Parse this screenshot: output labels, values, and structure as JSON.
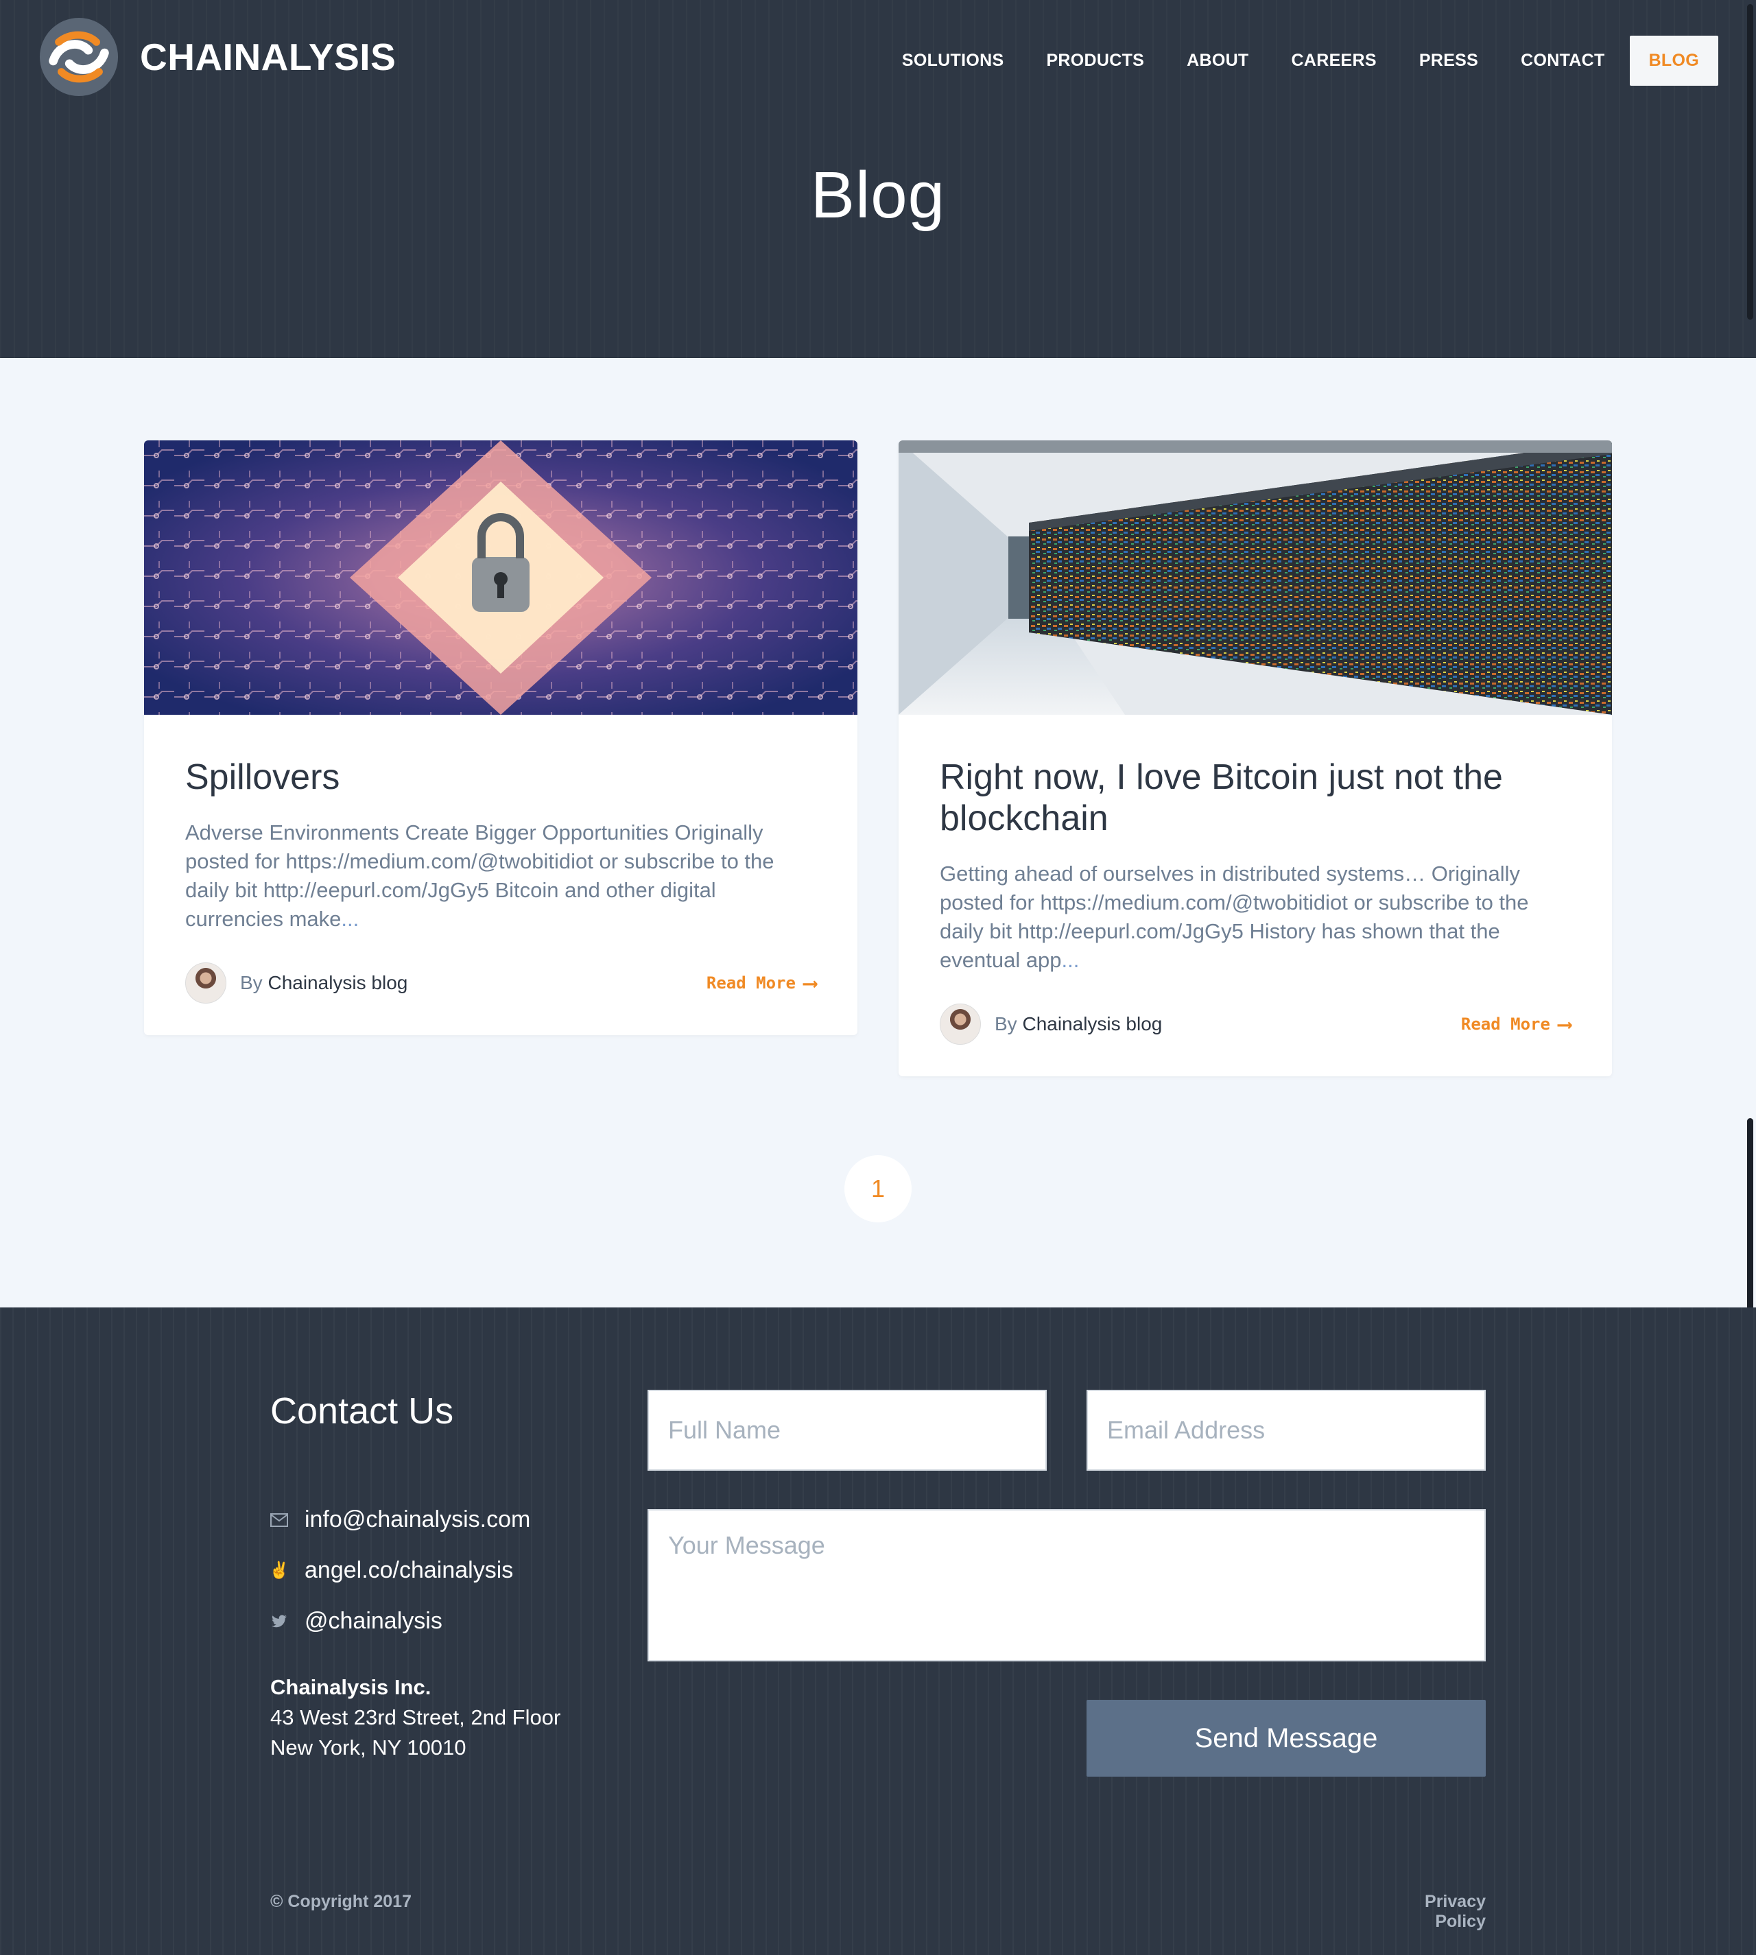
{
  "brand": {
    "name": "CHAINALYSIS",
    "accent_color": "#f08a24",
    "dark_color": "#2e3744"
  },
  "nav": {
    "items": [
      {
        "label": "SOLUTIONS"
      },
      {
        "label": "PRODUCTS"
      },
      {
        "label": "ABOUT"
      },
      {
        "label": "CAREERS"
      },
      {
        "label": "PRESS"
      },
      {
        "label": "CONTACT"
      },
      {
        "label": "BLOG",
        "active": true
      }
    ]
  },
  "page": {
    "title": "Blog"
  },
  "posts": [
    {
      "title": "Spillovers",
      "excerpt": "Adverse Environments Create Bigger Opportunities Originally posted for https://medium.com/@twobitidiot or subscribe to the daily bit http://eepurl.com/JgGy5 Bitcoin and other digital currencies make",
      "ellipsis": "...",
      "by": "By",
      "author": "Chainalysis blog",
      "read_more": "Read More",
      "image": "circuit-padlock-image"
    },
    {
      "title": "Right now, I love Bitcoin just not the blockchain",
      "excerpt": "Getting ahead of ourselves in distributed systems… Originally posted for https://medium.com/@twobitidiot or subscribe to the daily bit http://eepurl.com/JgGy5 History has shown that the eventual app",
      "ellipsis": "...",
      "by": "By",
      "author": "Chainalysis blog",
      "read_more": "Read More",
      "image": "server-racks-image"
    }
  ],
  "pagination": {
    "current": "1"
  },
  "footer": {
    "contact_title": "Contact Us",
    "email": "info@chainalysis.com",
    "angel": "angel.co/chainalysis",
    "twitter": "@chainalysis",
    "company_name": "Chainalysis Inc.",
    "address_line1": "43 West 23rd Street, 2nd Floor",
    "address_line2": "New York, NY 10010",
    "form": {
      "name_placeholder": "Full Name",
      "email_placeholder": "Email Address",
      "message_placeholder": "Your Message",
      "send_label": "Send Message"
    },
    "copyright": "© Copyright 2017",
    "privacy": "Privacy Policy"
  }
}
